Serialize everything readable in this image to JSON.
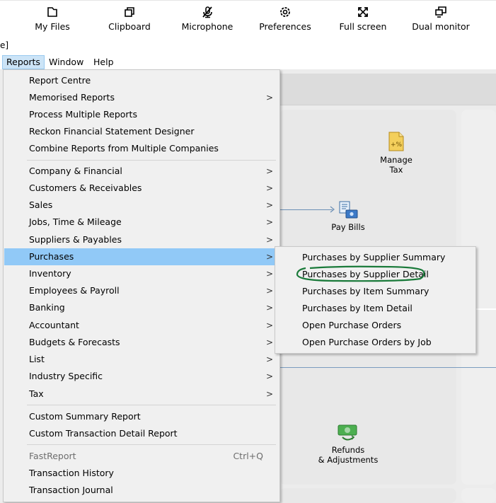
{
  "toolbar": {
    "buttons": [
      {
        "label": "My Files",
        "icon": "folder-icon"
      },
      {
        "label": "Clipboard",
        "icon": "clipboard-icon"
      },
      {
        "label": "Microphone",
        "icon": "microphone-muted-icon"
      },
      {
        "label": "Preferences",
        "icon": "gear-icon"
      },
      {
        "label": "Full screen",
        "icon": "fullscreen-icon"
      },
      {
        "label": "Dual monitor",
        "icon": "dual-monitor-icon"
      }
    ]
  },
  "title_fragment": "e]",
  "menubar": {
    "items": [
      {
        "label": "Reports",
        "active": true
      },
      {
        "label": "Window",
        "active": false
      },
      {
        "label": "Help",
        "active": false
      }
    ]
  },
  "reports_menu": {
    "items": [
      {
        "label": "Report Centre",
        "submenu": false
      },
      {
        "label": "Memorised Reports",
        "submenu": true
      },
      {
        "label": "Process Multiple Reports",
        "submenu": false
      },
      {
        "label": "Reckon Financial Statement Designer",
        "submenu": false
      },
      {
        "label": "Combine Reports from Multiple Companies",
        "submenu": false
      },
      {
        "label": "Company & Financial",
        "submenu": true
      },
      {
        "label": "Customers & Receivables",
        "submenu": true
      },
      {
        "label": "Sales",
        "submenu": true
      },
      {
        "label": "Jobs, Time & Mileage",
        "submenu": true
      },
      {
        "label": "Suppliers & Payables",
        "submenu": true
      },
      {
        "label": "Purchases",
        "submenu": true,
        "highlighted": true
      },
      {
        "label": "Inventory",
        "submenu": true
      },
      {
        "label": "Employees & Payroll",
        "submenu": true
      },
      {
        "label": "Banking",
        "submenu": true
      },
      {
        "label": "Accountant",
        "submenu": true
      },
      {
        "label": "Budgets & Forecasts",
        "submenu": true
      },
      {
        "label": "List",
        "submenu": true
      },
      {
        "label": "Industry Specific",
        "submenu": true
      },
      {
        "label": "Tax",
        "submenu": true
      },
      {
        "label": "Custom Summary Report",
        "submenu": false
      },
      {
        "label": "Custom Transaction Detail Report",
        "submenu": false
      },
      {
        "label": "FastReport",
        "submenu": false,
        "disabled": true,
        "shortcut": "Ctrl+Q"
      },
      {
        "label": "Transaction History",
        "submenu": false
      },
      {
        "label": "Transaction Journal",
        "submenu": false
      }
    ]
  },
  "purchases_submenu": {
    "items": [
      {
        "label": "Purchases by Supplier Summary"
      },
      {
        "label": "Purchases by Supplier Detail",
        "annotated": true
      },
      {
        "label": "Purchases by Item Summary"
      },
      {
        "label": "Purchases by Item Detail"
      },
      {
        "label": "Open Purchase Orders"
      },
      {
        "label": "Open Purchase Orders by Job"
      }
    ]
  },
  "background": {
    "manage_tax": "Manage\nTax",
    "pay_bills": "Pay Bills",
    "refunds": "Refunds\n& Adjustments"
  },
  "colors": {
    "highlight": "#91c9f7",
    "menu_bg": "#f0f0f0",
    "annotation": "#1a7a3a",
    "active_menubar": "#cce4f7"
  }
}
